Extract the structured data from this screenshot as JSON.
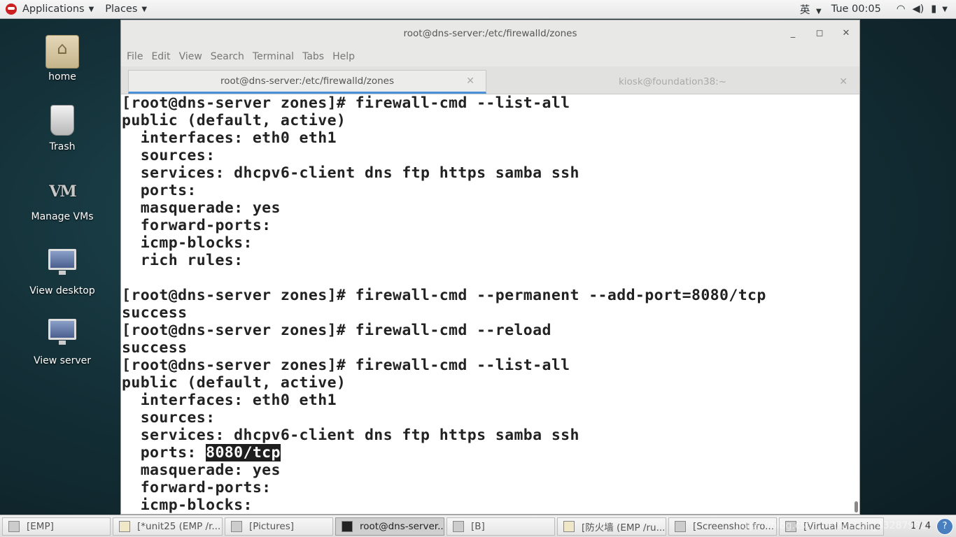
{
  "top_panel": {
    "applications_label": "Applications",
    "places_label": "Places",
    "input_method": "英",
    "clock": "Tue 00:05"
  },
  "desktop_icons": [
    {
      "label": "home",
      "icon": "home-folder-icon"
    },
    {
      "label": "Trash",
      "icon": "trash-icon"
    },
    {
      "label": "Manage VMs",
      "icon": "vm-icon"
    },
    {
      "label": "View desktop",
      "icon": "monitor-icon"
    },
    {
      "label": "View server",
      "icon": "monitor-icon"
    }
  ],
  "window": {
    "title": "root@dns-server:/etc/firewalld/zones",
    "menu": [
      "File",
      "Edit",
      "View",
      "Search",
      "Terminal",
      "Tabs",
      "Help"
    ],
    "tabs": [
      {
        "label": "root@dns-server:/etc/firewalld/zones",
        "active": true
      },
      {
        "label": "kiosk@foundation38:~",
        "active": false
      }
    ]
  },
  "terminal": {
    "lines": [
      "[root@dns-server zones]# firewall-cmd --list-all",
      "public (default, active)",
      "  interfaces: eth0 eth1",
      "  sources:",
      "  services: dhcpv6-client dns ftp https samba ssh",
      "  ports:",
      "  masquerade: yes",
      "  forward-ports:",
      "  icmp-blocks:",
      "  rich rules:",
      "",
      "[root@dns-server zones]# firewall-cmd --permanent --add-port=8080/tcp",
      "success",
      "[root@dns-server zones]# firewall-cmd --reload",
      "success",
      "[root@dns-server zones]# firewall-cmd --list-all",
      "public (default, active)",
      "  interfaces: eth0 eth1",
      "  sources:",
      "  services: dhcpv6-client dns ftp https samba ssh"
    ],
    "highlight_line_prefix": "  ports: ",
    "highlight_text": "8080/tcp",
    "tail_lines": [
      "  masquerade: yes",
      "  forward-ports:",
      "  icmp-blocks:"
    ]
  },
  "taskbar": {
    "items": [
      {
        "label": "[EMP]",
        "icon": "window-icon"
      },
      {
        "label": "[*unit25 (EMP /r...",
        "icon": "text-editor-icon"
      },
      {
        "label": "[Pictures]",
        "icon": "window-icon"
      },
      {
        "label": "root@dns-server...",
        "icon": "terminal-icon",
        "active": true
      },
      {
        "label": "[B]",
        "icon": "window-icon"
      },
      {
        "label": "[防火墙 (EMP /ru...",
        "icon": "text-editor-icon"
      },
      {
        "label": "[Screenshot fro...",
        "icon": "screenshot-icon"
      },
      {
        "label": "[Virtual Machine ...",
        "icon": "vm-icon"
      }
    ],
    "pager": "1 / 4",
    "watermark": "https://blog.csdn.net/weixin_43287982"
  }
}
